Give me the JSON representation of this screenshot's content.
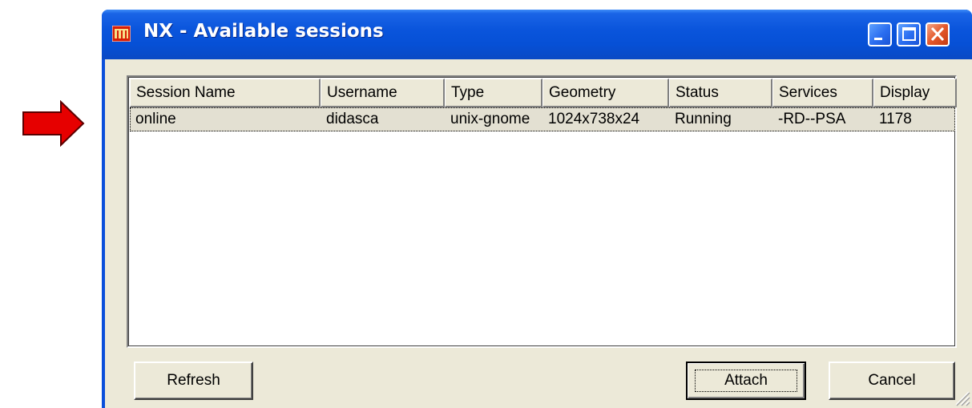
{
  "window": {
    "title": "NX - Available sessions",
    "app_icon": "nx-app-icon"
  },
  "titlebar_buttons": {
    "minimize": "minimize-icon",
    "maximize": "maximize-icon",
    "close": "close-icon"
  },
  "annotation": {
    "arrow_color": "#e60000",
    "arrow_icon": "red-arrow-right-icon"
  },
  "sessions_table": {
    "columns": [
      "Session Name",
      "Username",
      "Type",
      "Geometry",
      "Status",
      "Services",
      "Display"
    ],
    "rows": [
      {
        "session_name": "online",
        "username": "didasca",
        "type": "unix-gnome",
        "geometry": "1024x738x24",
        "status": "Running",
        "services": "-RD--PSA",
        "display": "1178"
      }
    ]
  },
  "buttons": {
    "refresh": "Refresh",
    "attach": "Attach",
    "cancel": "Cancel"
  },
  "colors": {
    "titlebar": "#0a55dc",
    "dialog_face": "#ece9d8",
    "close_button": "#e4582b"
  }
}
